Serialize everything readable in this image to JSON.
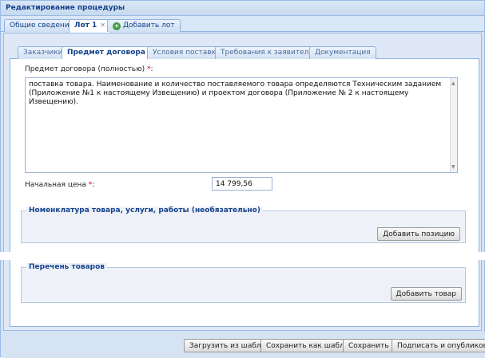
{
  "window": {
    "title": "Редактирование процедуры"
  },
  "top_tabs": [
    {
      "label": "Общие сведения"
    },
    {
      "label": "Лот 1"
    },
    {
      "label": "Добавить лот"
    }
  ],
  "sub_tabs": [
    {
      "label": "Заказчики"
    },
    {
      "label": "Предмет договора"
    },
    {
      "label": "Условия поставки"
    },
    {
      "label": "Требования к заявителям"
    },
    {
      "label": "Документация"
    }
  ],
  "form": {
    "subject_label": "Предмет договора (полностью)",
    "required_mark": "*",
    "colon": ":",
    "subject_value": "поставка товара. Наименование и количество поставляемого товара определяются Техническим заданием (Приложение №1 к настоящему Извещению) и проектом договора (Приложение № 2 к настоящему Извещению).",
    "price_label": "Начальная цена",
    "price_value": "14 799,56"
  },
  "nomenclature": {
    "legend": "Номенклатура товара, услуги, работы (необязательно)",
    "add_button": "Добавить позицию"
  },
  "goods_list": {
    "legend": "Перечень товаров",
    "add_button": "Добавить товар"
  },
  "footer": {
    "load_template": "Загрузить из шаблона",
    "save_as_template": "Сохранить как шаблон",
    "save": "Сохранить",
    "sign_publish": "Подписать и опубликовать"
  }
}
